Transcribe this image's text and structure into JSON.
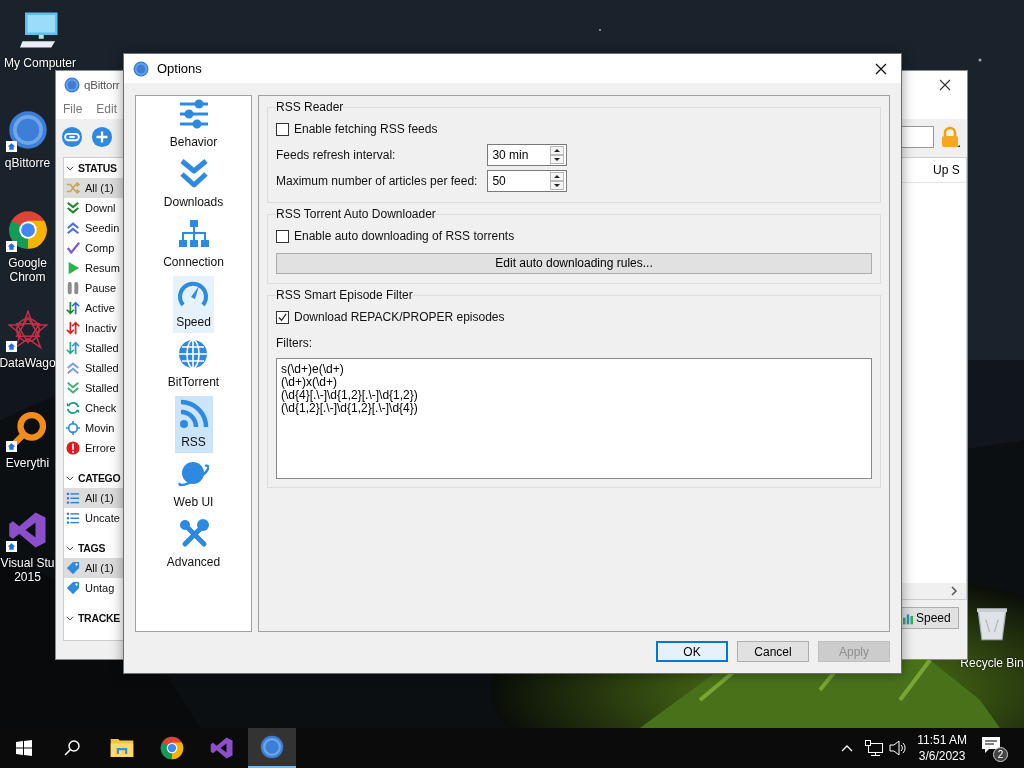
{
  "desktop": {
    "icons": [
      {
        "kind": "computer",
        "lines": [
          "My Computer"
        ],
        "shortcut": false
      },
      {
        "kind": "qbittorrent",
        "lines": [
          "qBittorre"
        ],
        "shortcut": true
      },
      {
        "kind": "chrome",
        "lines": [
          "Google",
          "Chrom"
        ],
        "shortcut": true
      },
      {
        "kind": "datawagon",
        "lines": [
          "DataWago"
        ],
        "shortcut": true
      },
      {
        "kind": "everything",
        "lines": [
          "Everythi"
        ],
        "shortcut": true
      },
      {
        "kind": "visualstudio",
        "lines": [
          "Visual Stu",
          "2015"
        ],
        "shortcut": true
      }
    ],
    "recycle_bin": {
      "kind": "recycle",
      "lines": [
        "Recycle Bin"
      ],
      "shortcut": false
    }
  },
  "main_window": {
    "title": "qBittorr",
    "menu": [
      "File",
      "Edit"
    ],
    "toolbar": [
      {
        "kind": "link"
      },
      {
        "kind": "add"
      }
    ],
    "sidebar": [
      {
        "title": "STATUS",
        "expanded": true,
        "items": [
          {
            "label": "All (1)",
            "kind": "shuffle",
            "selected": true
          },
          {
            "label": "Downl",
            "kind": "down",
            "selected": false
          },
          {
            "label": "Seedin",
            "kind": "up",
            "selected": false
          },
          {
            "label": "Comp",
            "kind": "check",
            "selected": false
          },
          {
            "label": "Resum",
            "kind": "play",
            "selected": false
          },
          {
            "label": "Pause",
            "kind": "pause",
            "selected": false
          },
          {
            "label": "Active",
            "kind": "active",
            "selected": false
          },
          {
            "label": "Inactiv",
            "kind": "inactive",
            "selected": false
          },
          {
            "label": "Stalled",
            "kind": "stalled",
            "selected": false
          },
          {
            "label": "Stalled",
            "kind": "stalled_up",
            "selected": false
          },
          {
            "label": "Stalled",
            "kind": "stalled_down",
            "selected": false
          },
          {
            "label": "Check",
            "kind": "checking",
            "selected": false
          },
          {
            "label": "Movin",
            "kind": "moving",
            "selected": false
          },
          {
            "label": "Errore",
            "kind": "error",
            "selected": false
          }
        ]
      },
      {
        "title": "CATEGO",
        "expanded": true,
        "items": [
          {
            "label": "All (1)",
            "kind": "list",
            "selected": true
          },
          {
            "label": "Uncate",
            "kind": "list",
            "selected": false
          }
        ]
      },
      {
        "title": "TAGS",
        "expanded": true,
        "items": [
          {
            "label": "All (1)",
            "kind": "tag",
            "selected": true
          },
          {
            "label": "Untag",
            "kind": "tag",
            "selected": false
          }
        ]
      },
      {
        "title": "TRACKE",
        "expanded": true
      }
    ],
    "column_header": "Up S",
    "speed_button": "Speed"
  },
  "options": {
    "title": "Options",
    "pages": [
      {
        "label": "Behavior",
        "kind": "sliders",
        "selected": false,
        "hovered": false
      },
      {
        "label": "Downloads",
        "kind": "chevrons",
        "selected": false,
        "hovered": false
      },
      {
        "label": "Connection",
        "kind": "sitemap",
        "selected": false,
        "hovered": false
      },
      {
        "label": "Speed",
        "kind": "gauge",
        "selected": false,
        "hovered": true
      },
      {
        "label": "BitTorrent",
        "kind": "globe",
        "selected": false,
        "hovered": false
      },
      {
        "label": "RSS",
        "kind": "rss",
        "selected": true,
        "hovered": false
      },
      {
        "label": "Web UI",
        "kind": "planet",
        "selected": false,
        "hovered": false
      },
      {
        "label": "Advanced",
        "kind": "tools",
        "selected": false,
        "hovered": false
      }
    ],
    "rss_reader": {
      "title": "RSS Reader",
      "enable_fetching": {
        "label": "Enable fetching RSS feeds",
        "checked": false
      },
      "refresh_interval": {
        "label": "Feeds refresh interval:",
        "value": "30 min"
      },
      "max_articles": {
        "label": "Maximum number of articles per feed:",
        "value": "50"
      }
    },
    "auto_downloader": {
      "title": "RSS Torrent Auto Downloader",
      "enable": {
        "label": "Enable auto downloading of RSS torrents",
        "checked": false
      },
      "edit_rules_button": "Edit auto downloading rules..."
    },
    "smart_filter": {
      "title": "RSS Smart Episode Filter",
      "download_repack": {
        "label": "Download REPACK/PROPER episodes",
        "checked": true
      },
      "filters_label": "Filters:",
      "filters": [
        "s(\\d+)e(\\d+)",
        "(\\d+)x(\\d+)",
        "(\\d{4}[.\\-]\\d{1,2}[.\\-]\\d{1,2})",
        "(\\d{1,2}[.\\-]\\d{1,2}[.\\-]\\d{4})"
      ]
    },
    "buttons": [
      {
        "label": "OK",
        "default": true,
        "disabled": false
      },
      {
        "label": "Cancel",
        "default": false,
        "disabled": false
      },
      {
        "label": "Apply",
        "default": false,
        "disabled": true
      }
    ]
  },
  "taskbar": {
    "apps": [
      {
        "kind": "explorer",
        "active": false
      },
      {
        "kind": "chrome",
        "active": false
      },
      {
        "kind": "visualstudio",
        "active": false
      },
      {
        "kind": "qbittorrent",
        "active": true
      }
    ],
    "clock": {
      "time": "11:51 AM",
      "date": "3/6/2023"
    },
    "notifications": "2"
  }
}
